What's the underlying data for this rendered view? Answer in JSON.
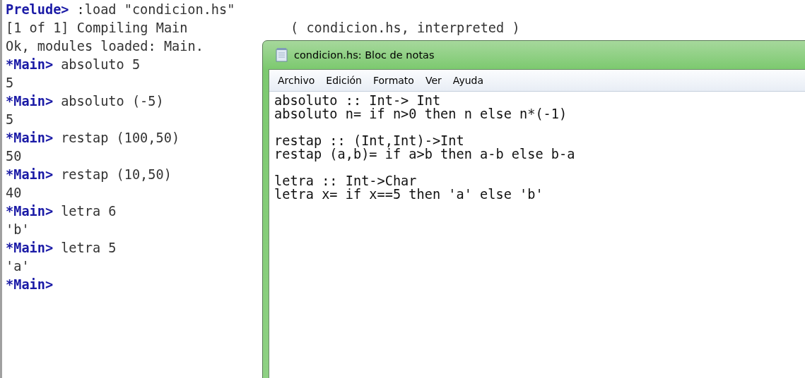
{
  "console": {
    "lines": [
      {
        "prompt": "Prelude>",
        "text": ":load \"condicion.hs\""
      },
      {
        "text": "[1 of 1] Compiling Main             ( condicion.hs, interpreted )"
      },
      {
        "text": "Ok, modules loaded: Main."
      },
      {
        "prompt": "*Main>",
        "text": "absoluto 5"
      },
      {
        "text": "5"
      },
      {
        "prompt": "*Main>",
        "text": "absoluto (-5)"
      },
      {
        "text": "5"
      },
      {
        "prompt": "*Main>",
        "text": "restap (100,50)"
      },
      {
        "text": "50"
      },
      {
        "prompt": "*Main>",
        "text": "restap (10,50)"
      },
      {
        "text": "40"
      },
      {
        "prompt": "*Main>",
        "text": "letra 6"
      },
      {
        "text": "'b'"
      },
      {
        "prompt": "*Main>",
        "text": "letra 5"
      },
      {
        "text": "'a'"
      },
      {
        "prompt": "*Main>"
      }
    ]
  },
  "notepad": {
    "title": "condicion.hs: Bloc de notas",
    "menu": [
      "Archivo",
      "Edición",
      "Formato",
      "Ver",
      "Ayuda"
    ],
    "code_blocks": [
      [
        "absoluto :: Int-> Int",
        "absoluto n= if n>0 then n else n*(-1)"
      ],
      [
        "restap :: (Int,Int)->Int",
        "restap (a,b)= if a>b then a-b else b-a"
      ],
      [
        "letra :: Int->Char",
        "letra x= if x==5 then 'a' else 'b'"
      ]
    ]
  }
}
